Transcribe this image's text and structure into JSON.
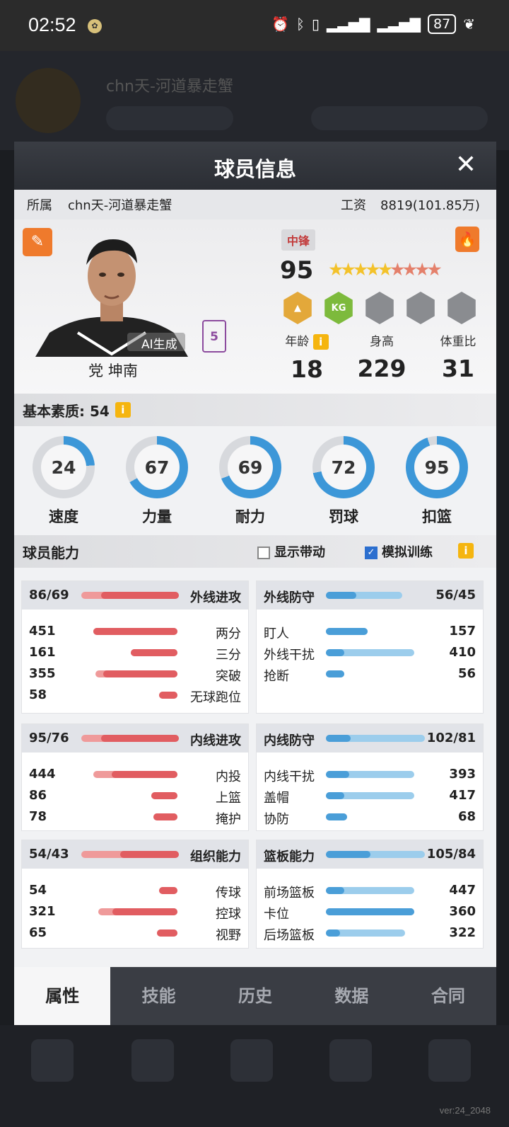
{
  "status_bar": {
    "time": "02:52",
    "battery": "87"
  },
  "background": {
    "team_name": "chn天-河道暴走蟹",
    "version": "ver:24_2048"
  },
  "modal": {
    "title": "球员信息",
    "affiliation_label": "所属",
    "affiliation": "chn天-河道暴走蟹",
    "salary_label": "工资",
    "salary": "8819(101.85万)",
    "player": {
      "name": "党 坤南",
      "ai_tag": "AI生成",
      "jersey": "5",
      "position": "中锋",
      "overall": "95",
      "stars_gold": 5,
      "stars_total": 9,
      "badges": [
        "gold-badge",
        "KG",
        "locked",
        "locked",
        "locked"
      ],
      "age_label": "年龄",
      "age": "18",
      "height_label": "身高",
      "height": "229",
      "weight_label": "体重比",
      "weight": "31"
    },
    "basic": {
      "label": "基本素质: 54",
      "rings": [
        {
          "label": "速度",
          "value": "24",
          "pct": 24
        },
        {
          "label": "力量",
          "value": "67",
          "pct": 67
        },
        {
          "label": "耐力",
          "value": "69",
          "pct": 69
        },
        {
          "label": "罚球",
          "value": "72",
          "pct": 72
        },
        {
          "label": "扣篮",
          "value": "95",
          "pct": 95
        }
      ]
    },
    "ability": {
      "label": "球员能力",
      "show_bonus": "显示带动",
      "sim_training": "模拟训练"
    },
    "cards": [
      {
        "title": "外线进攻",
        "score": "86/69",
        "color": "r",
        "side": "left",
        "fill": 0.8,
        "rows": [
          {
            "n": "451",
            "l": "两分",
            "w": 0.9,
            "fill": 0.9
          },
          {
            "n": "161",
            "l": "三分",
            "w": 0.5,
            "fill": 0.5
          },
          {
            "n": "355",
            "l": "突破",
            "w": 0.88,
            "fill": 0.8
          },
          {
            "n": "58",
            "l": "无球跑位",
            "w": 0.2,
            "fill": 0.2
          }
        ]
      },
      {
        "title": "外线防守",
        "score": "56/45",
        "color": "b",
        "side": "right",
        "fill": 0.4,
        "rows": [
          {
            "n": "157",
            "l": "盯人",
            "w": 0.45,
            "fill": 0.45
          },
          {
            "n": "410",
            "l": "外线干扰",
            "w": 0.95,
            "fill": 0.2
          },
          {
            "n": "56",
            "l": "抢断",
            "w": 0.2,
            "fill": 0.2
          }
        ]
      },
      {
        "title": "内线进攻",
        "score": "95/76",
        "color": "r",
        "side": "left",
        "fill": 0.8,
        "rows": [
          {
            "n": "444",
            "l": "内投",
            "w": 0.9,
            "fill": 0.7
          },
          {
            "n": "86",
            "l": "上篮",
            "w": 0.28,
            "fill": 0.28
          },
          {
            "n": "78",
            "l": "掩护",
            "w": 0.26,
            "fill": 0.26
          }
        ]
      },
      {
        "title": "内线防守",
        "score": "102/81",
        "color": "b",
        "side": "right",
        "fill": 0.25,
        "rows": [
          {
            "n": "393",
            "l": "内线干扰",
            "w": 0.95,
            "fill": 0.25
          },
          {
            "n": "417",
            "l": "盖帽",
            "w": 0.95,
            "fill": 0.2
          },
          {
            "n": "68",
            "l": "协防",
            "w": 0.23,
            "fill": 0.23
          }
        ]
      },
      {
        "title": "组织能力",
        "score": "54/43",
        "color": "r",
        "side": "left",
        "fill": 0.6,
        "rows": [
          {
            "n": "54",
            "l": "传球",
            "w": 0.2,
            "fill": 0.2
          },
          {
            "n": "321",
            "l": "控球",
            "w": 0.85,
            "fill": 0.7
          },
          {
            "n": "65",
            "l": "视野",
            "w": 0.22,
            "fill": 0.22
          }
        ]
      },
      {
        "title": "篮板能力",
        "score": "105/84",
        "color": "b",
        "side": "right",
        "fill": 0.45,
        "rows": [
          {
            "n": "447",
            "l": "前场篮板",
            "w": 0.95,
            "fill": 0.2
          },
          {
            "n": "360",
            "l": "卡位",
            "w": 0.95,
            "fill": 0.95
          },
          {
            "n": "322",
            "l": "后场篮板",
            "w": 0.85,
            "fill": 0.15
          }
        ]
      }
    ],
    "tabs": [
      "属性",
      "技能",
      "历史",
      "数据",
      "合同"
    ],
    "active_tab": 0
  }
}
